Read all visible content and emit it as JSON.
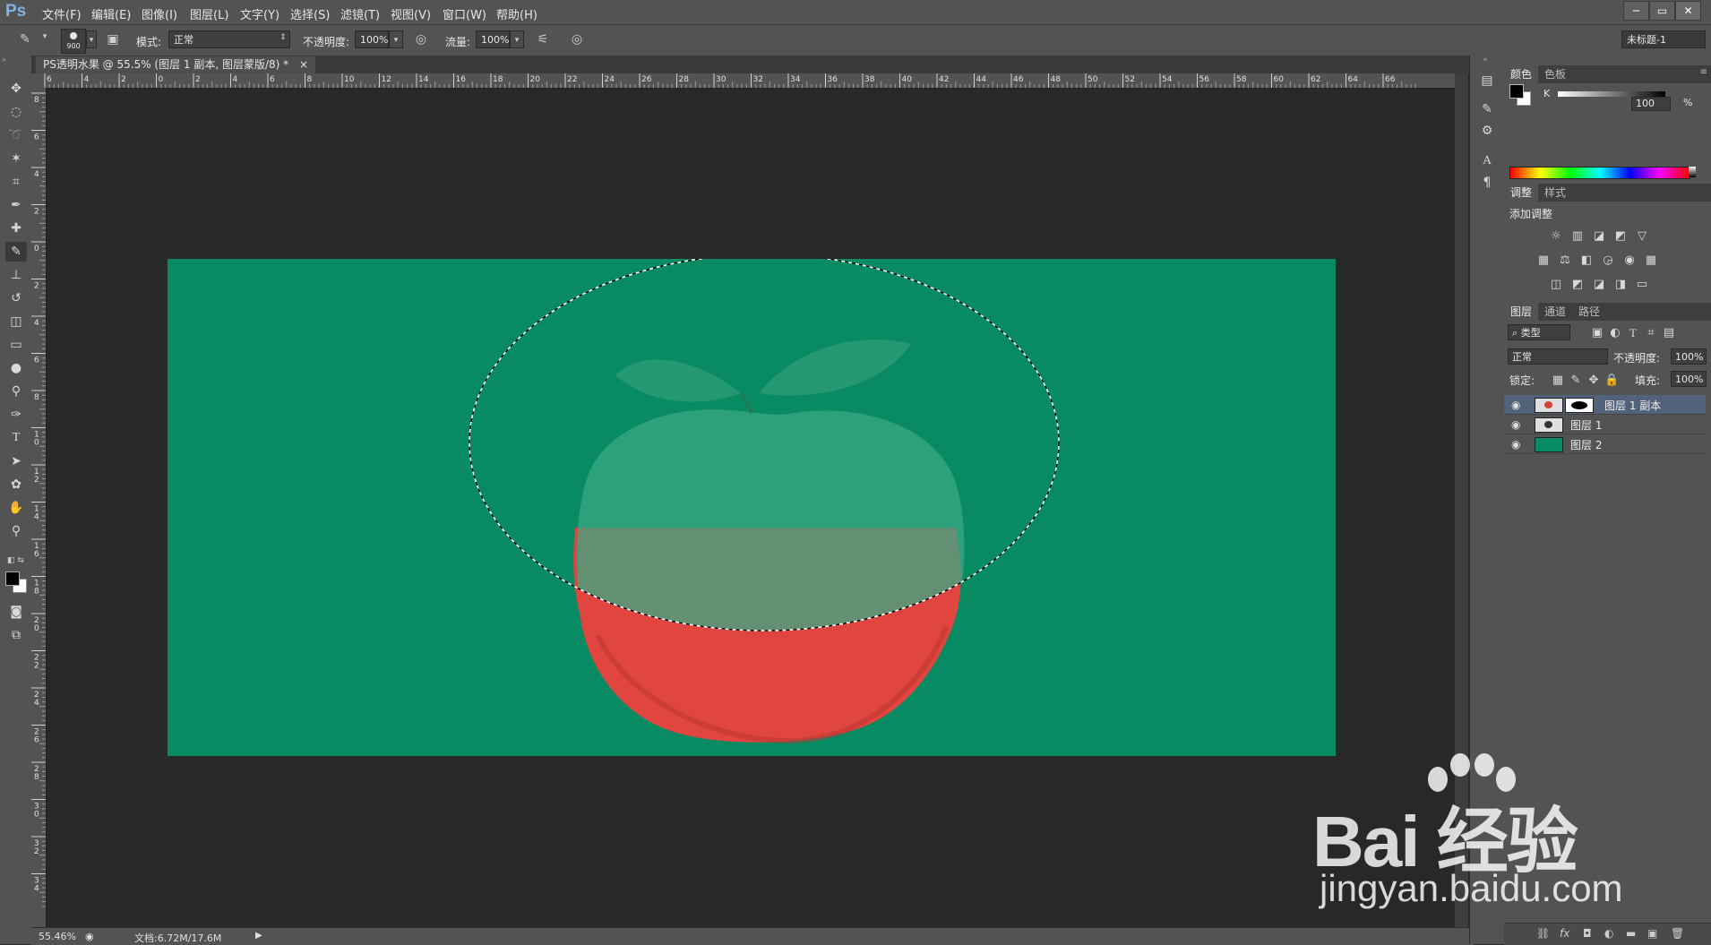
{
  "app": {
    "logo": "Ps"
  },
  "menu": [
    "文件(F)",
    "编辑(E)",
    "图像(I)",
    "图层(L)",
    "文字(Y)",
    "选择(S)",
    "滤镜(T)",
    "视图(V)",
    "窗口(W)",
    "帮助(H)"
  ],
  "window_buttons": [
    "─",
    "▭",
    "✕"
  ],
  "options": {
    "brush_size": "900",
    "mode_label": "模式:",
    "mode_value": "正常",
    "opacity_label": "不透明度:",
    "opacity_value": "100%",
    "flow_label": "流量:",
    "flow_value": "100%",
    "workspace": "未标题-1"
  },
  "document": {
    "tab_title": "PS透明水果 @ 55.5% (图层 1 副本, 图层蒙版/8) *",
    "close": "×"
  },
  "ruler_top": [
    "6",
    "4",
    "2",
    "0",
    "2",
    "4",
    "6",
    "8",
    "10",
    "12",
    "14",
    "16",
    "18",
    "20",
    "22",
    "24",
    "26",
    "28",
    "30",
    "32",
    "34",
    "36",
    "38",
    "40",
    "42",
    "44",
    "46",
    "48",
    "50",
    "52",
    "54",
    "56",
    "58",
    "60",
    "62",
    "64",
    "66"
  ],
  "ruler_left": [
    "8",
    "6",
    "4",
    "2",
    "0",
    "2",
    "4",
    "6",
    "8",
    "10",
    "12",
    "14",
    "16",
    "18",
    "20",
    "22",
    "24",
    "26",
    "28",
    "30",
    "32",
    "34"
  ],
  "status": {
    "zoom": "55.46%",
    "doc_size": "文档:6.72M/17.6M"
  },
  "color_panel": {
    "tabs": [
      "颜色",
      "色板"
    ],
    "channel": "K",
    "value": "100",
    "unit": "%"
  },
  "adjust_panel": {
    "tabs": [
      "调整",
      "样式"
    ],
    "title": "添加调整",
    "row1": [
      "☼",
      "▥",
      "◪",
      "◩",
      "▽"
    ],
    "row2": [
      "▦",
      "⚖",
      "◧",
      "◶",
      "◉",
      "▦"
    ],
    "row3": [
      "◫",
      "◩",
      "◪",
      "◨",
      "▭"
    ]
  },
  "layers_panel": {
    "tabs": [
      "图层",
      "通道",
      "路径"
    ],
    "filter_kind": "类型",
    "blend_mode": "正常",
    "opacity_label": "不透明度:",
    "opacity_value": "100%",
    "lock_label": "锁定:",
    "fill_label": "填充:",
    "fill_value": "100%",
    "layers": [
      {
        "name": "图层 1 副本",
        "selected": true
      },
      {
        "name": "图层 1",
        "selected": false
      },
      {
        "name": "图层 2",
        "selected": false
      }
    ],
    "footer_icons": [
      "⛓",
      "fx",
      "◘",
      "◐",
      "▬",
      "▣",
      "🗑"
    ]
  },
  "colors": {
    "canvas_bg": "#088a62",
    "apple_red": "#e0453f",
    "workspace": "#282828",
    "panel": "#535353",
    "selected_layer": "#52627a"
  },
  "watermark": {
    "brand": "Bai 经验",
    "url": "jingyan.baidu.com"
  }
}
